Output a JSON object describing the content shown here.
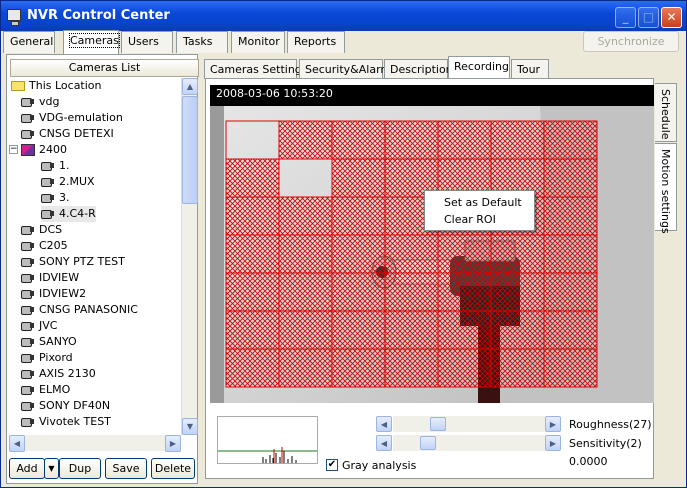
{
  "window": {
    "title": "NVR Control Center",
    "minimize": "_",
    "maximize": "□",
    "close": "✕"
  },
  "top_tabs": [
    {
      "label": "General",
      "active": false
    },
    {
      "label": "Cameras",
      "active": true
    },
    {
      "label": "Users",
      "active": false
    },
    {
      "label": "Tasks",
      "active": false
    },
    {
      "label": "Monitor",
      "active": false
    },
    {
      "label": "Reports",
      "active": false
    }
  ],
  "sync_button": "Synchronize",
  "cameras_list": {
    "header": "Cameras List",
    "items": [
      {
        "label": "This Location",
        "type": "folder",
        "level": 0
      },
      {
        "label": "vdg",
        "type": "camera",
        "level": 1
      },
      {
        "label": "VDG-emulation",
        "type": "camera",
        "level": 1
      },
      {
        "label": "CNSG DETEXI",
        "type": "camera",
        "level": 1
      },
      {
        "label": "2400",
        "type": "multi",
        "level": 1,
        "expander": "−"
      },
      {
        "label": "1.",
        "type": "camera",
        "level": 2
      },
      {
        "label": "2.MUX",
        "type": "camera",
        "level": 2
      },
      {
        "label": "3.",
        "type": "camera",
        "level": 2
      },
      {
        "label": "4.C4-R",
        "type": "camera",
        "level": 2,
        "selected": true
      },
      {
        "label": "DCS",
        "type": "camera",
        "level": 1
      },
      {
        "label": "C205",
        "type": "camera",
        "level": 1
      },
      {
        "label": "SONY PTZ TEST",
        "type": "camera",
        "level": 1
      },
      {
        "label": "IDVIEW",
        "type": "camera",
        "level": 1
      },
      {
        "label": "IDVIEW2",
        "type": "camera",
        "level": 1
      },
      {
        "label": "CNSG PANASONIC",
        "type": "camera",
        "level": 1
      },
      {
        "label": "JVC",
        "type": "camera",
        "level": 1
      },
      {
        "label": "SANYO",
        "type": "camera",
        "level": 1
      },
      {
        "label": "Pixord",
        "type": "camera",
        "level": 1
      },
      {
        "label": "AXIS 2130",
        "type": "camera",
        "level": 1
      },
      {
        "label": "ELMO",
        "type": "camera",
        "level": 1
      },
      {
        "label": "SONY DF40N",
        "type": "camera",
        "level": 1
      },
      {
        "label": "Vivotek TEST",
        "type": "camera",
        "level": 1
      }
    ]
  },
  "list_buttons": {
    "add": "Add",
    "add_arrow": "▼",
    "dup": "Dup",
    "save": "Save",
    "delete": "Delete"
  },
  "sub_tabs": [
    {
      "label": "Cameras Settings",
      "active": false
    },
    {
      "label": "Security&Alarm",
      "active": false
    },
    {
      "label": "Description",
      "active": false
    },
    {
      "label": "Recording",
      "active": true
    },
    {
      "label": "Tour",
      "active": false
    }
  ],
  "side_tabs": [
    {
      "label": "Schedule",
      "active": false
    },
    {
      "label": "Motion settings",
      "active": true
    }
  ],
  "video": {
    "timestamp": "2008-03-06 10:53:20"
  },
  "context_menu": {
    "items": [
      "Set as Default",
      "Clear ROI"
    ]
  },
  "controls": {
    "roughness_label": "Roughness(27)",
    "roughness_value": 27,
    "sensitivity_label": "Sensitivity(2)",
    "sensitivity_value": 2,
    "value_readout": "0.0000",
    "gray_analysis_label": "Gray analysis",
    "gray_analysis_checked": true
  },
  "icons": {
    "scroll_up": "▲",
    "scroll_down": "▼",
    "scroll_left": "◀",
    "scroll_right": "▶",
    "checkmark": "✔"
  },
  "colors": {
    "roi_grid": "#e00000",
    "title_bar": "#0a48d8"
  }
}
